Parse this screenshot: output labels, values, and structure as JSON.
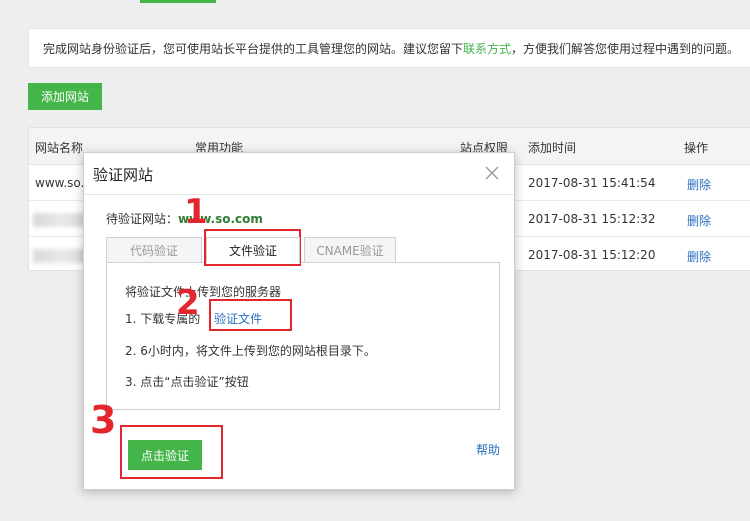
{
  "notice": {
    "text_before": "完成网站身份验证后，您可使用站长平台提供的工具管理您的网站。建议您留下",
    "link": "联系方式",
    "text_after": "，方便我们解答您使用过程中遇到的问题。"
  },
  "add_button": "添加网站",
  "table": {
    "headers": {
      "site_name": "网站名称",
      "functions": "常用功能",
      "permission": "站点权限",
      "added_time": "添加时间",
      "action": "操作"
    },
    "rows": [
      {
        "site": "www.so.c",
        "time": "2017-08-31 15:41:54",
        "action": "删除"
      },
      {
        "site": "",
        "time": "2017-08-31 15:12:32",
        "action": "删除"
      },
      {
        "site": "",
        "time": "2017-08-31 15:12:20",
        "action": "删除"
      }
    ]
  },
  "modal": {
    "title": "验证网站",
    "pending_label": "待验证网站：",
    "pending_domain": "www.so.com",
    "tabs": [
      "代码验证",
      "文件验证",
      "CNAME验证"
    ],
    "active_tab": 1,
    "steps": {
      "intro": "将验证文件上传到您的服务器",
      "step1_prefix": "1. 下载专属的",
      "step1_link": "验证文件",
      "step2": "2. 6小时内，将文件上传到您的网站根目录下。",
      "step3": "3. 点击“点击验证”按钮"
    },
    "verify_button": "点击验证",
    "help": "帮助"
  },
  "annotations": {
    "colors": {
      "mark": "#e3262e",
      "accent": "#44b549",
      "link": "#2a6fbf"
    },
    "numbers": [
      "1",
      "2",
      "3"
    ]
  }
}
